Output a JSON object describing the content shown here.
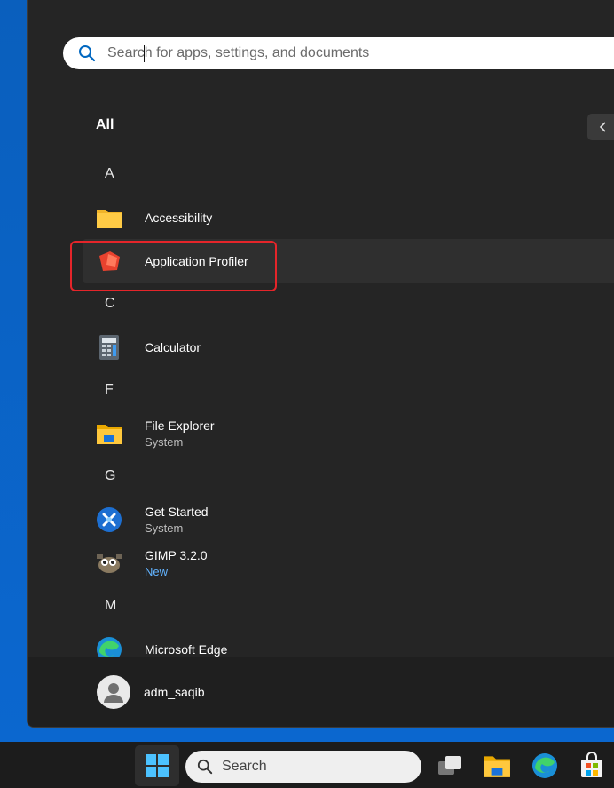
{
  "search": {
    "placeholder": "Search for apps, settings, and documents"
  },
  "all_label": "All",
  "sections": [
    {
      "letter": "A"
    },
    {
      "letter": "C"
    },
    {
      "letter": "F"
    },
    {
      "letter": "G"
    },
    {
      "letter": "M"
    }
  ],
  "apps": {
    "accessibility": {
      "name": "Accessibility",
      "icon": "folder-icon"
    },
    "application_profiler": {
      "name": "Application Profiler",
      "icon": "application-profiler-icon",
      "selected": true
    },
    "calculator": {
      "name": "Calculator",
      "icon": "calculator-icon"
    },
    "file_explorer": {
      "name": "File Explorer",
      "sub": "System",
      "icon": "file-explorer-icon"
    },
    "get_started": {
      "name": "Get Started",
      "sub": "System",
      "icon": "get-started-icon"
    },
    "gimp": {
      "name": "GIMP 3.2.0",
      "sub": "New",
      "icon": "gimp-icon"
    },
    "edge": {
      "name": "Microsoft Edge",
      "icon": "edge-icon"
    }
  },
  "user": {
    "name": "adm_saqib"
  },
  "taskbar": {
    "search_label": "Search"
  },
  "colors": {
    "highlight": "#e5252a",
    "new_badge": "#62b3ff",
    "menu_bg": "#252525"
  }
}
